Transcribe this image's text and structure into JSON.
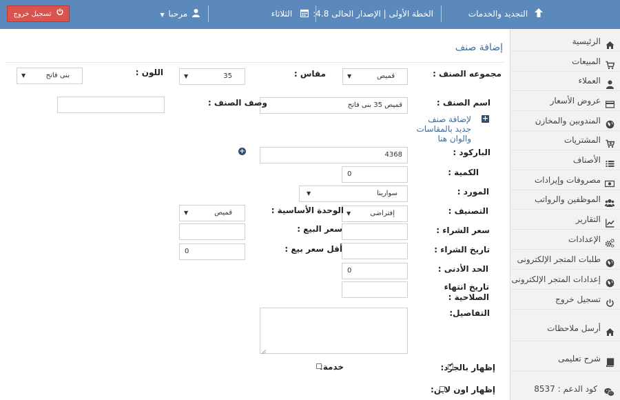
{
  "topbar": {
    "renew": "التجديد والخدمات",
    "plan": "الخطة الأولى | الإصدار الحالى 4.8:",
    "day": "الثلاثاء",
    "greeting": "مرحبا",
    "logout": "تسجيل خروج",
    "bar_color": "#5b89bb",
    "logout_color": "#d9534f"
  },
  "sidebar": {
    "items": [
      {
        "label": "الرئيسية",
        "icon": "home-icon"
      },
      {
        "label": "المبيعات",
        "icon": "cart-icon"
      },
      {
        "label": "العملاء",
        "icon": "user-icon"
      },
      {
        "label": "عروض الأسعار",
        "icon": "card-icon"
      },
      {
        "label": "المندوبين والمخازن",
        "icon": "globe-icon"
      },
      {
        "label": "المشتريات",
        "icon": "cart-plus-icon"
      },
      {
        "label": "الأصناف",
        "icon": "list-icon"
      },
      {
        "label": "مصروفات وإيرادات",
        "icon": "money-icon"
      },
      {
        "label": "الموظفين والرواتب",
        "icon": "users-icon"
      },
      {
        "label": "التقارير",
        "icon": "chart-icon"
      },
      {
        "label": "الإعدادات",
        "icon": "gears-icon"
      },
      {
        "label": "طلبات المتجر الإلكترونى",
        "icon": "globe-icon"
      },
      {
        "label": "إعدادات المتجر الإلكترونى",
        "icon": "globe-icon"
      },
      {
        "label": "تسجيل خروج",
        "icon": "power-icon"
      }
    ],
    "notes": "أرسل ملاحظات",
    "tutorial": "شرح تعليمى",
    "support": "كود الدعم : 8537"
  },
  "form": {
    "title": "إضافة صنف",
    "group_label": "مجموعه الصنف :",
    "group_value": "قميص",
    "size_label": "مقاس :",
    "size_value": "35",
    "color_label": "اللون :",
    "color_value": "بنى فاتح",
    "name_label": "اسم الصنف :",
    "name_value": "قميص 35 بنى فاتح",
    "desc_label": "وصف الصنف :",
    "desc_value": "",
    "add_link_lines": [
      "لإضافة صنف",
      "جديد بالمقاسات",
      "والوان هنا"
    ],
    "barcode_label": "الباركود :",
    "barcode_value": "4368",
    "qty_label": "الكمية :",
    "qty_value": "0",
    "supplier_label": "المورد :",
    "supplier_value": "سوارينا",
    "category_label": "التصنيف :",
    "category_value": "إفتراضى",
    "base_unit_label": "الوحدة الأساسية :",
    "base_unit_value": "قميص",
    "buy_price_label": "سعر الشراء :",
    "buy_price_value": "",
    "sell_price_label": "سعر البيع :",
    "sell_price_value": "",
    "buy_date_label": "تاريخ الشراء :",
    "buy_date_value": "",
    "min_sell_label": "أقل سعر بيع :",
    "min_sell_value": "0",
    "min_label": "الحد الأدنى :",
    "min_value": "0",
    "expiry_label_1": "تاريخ انتهاء",
    "expiry_label_2": "الصلاحية :",
    "expiry_value": "",
    "details_label": "التفاصيل:",
    "show_inventory_label": "إظهار بالجرد:",
    "show_inventory_checked": true,
    "service_label": "خدمة:",
    "service_checked": false,
    "show_online_label": "إظهار اون لاين:",
    "show_online_checked": false
  }
}
